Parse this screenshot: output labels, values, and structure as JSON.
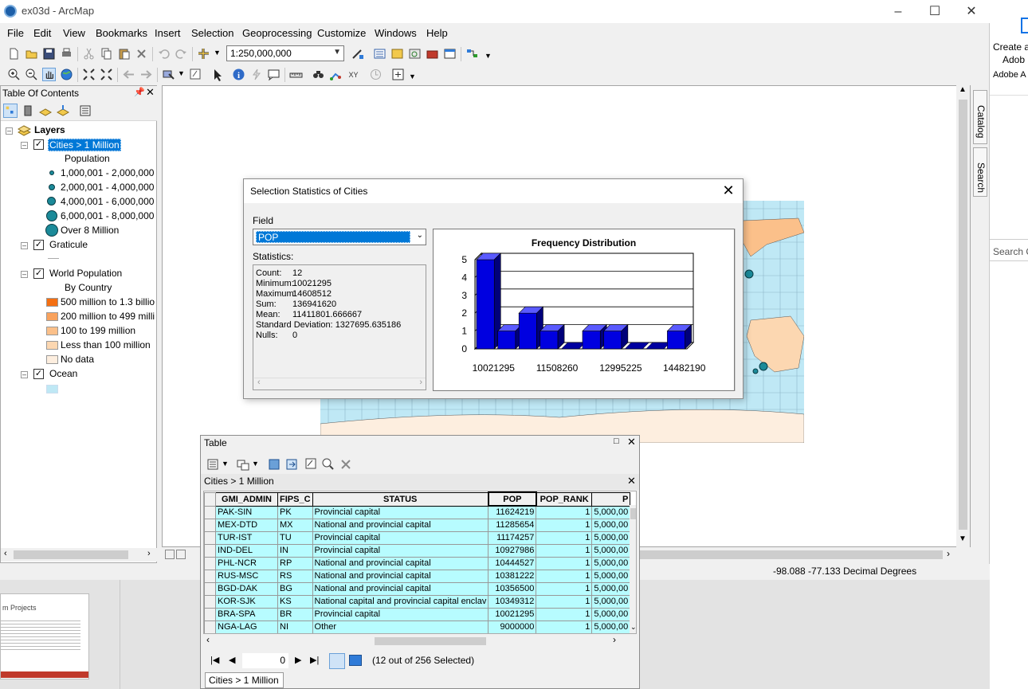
{
  "window": {
    "title": "ex03d - ArcMap"
  },
  "menu": [
    "File",
    "Edit",
    "View",
    "Bookmarks",
    "Insert",
    "Selection",
    "Geoprocessing",
    "Customize",
    "Windows",
    "Help"
  ],
  "toolbar": {
    "scale": "1:250,000,000"
  },
  "toc": {
    "title": "Table Of Contents",
    "root": "Layers",
    "cities_layer": "Cities > 1 Million",
    "cities_field": "Population",
    "cities_classes": [
      "1,000,001 - 2,000,000",
      "2,000,001 - 4,000,000",
      "4,000,001 - 6,000,000",
      "6,000,001 - 8,000,000",
      "Over 8 Million"
    ],
    "graticule_layer": "Graticule",
    "worldpop_layer": "World Population",
    "worldpop_field": "By Country",
    "worldpop_classes": [
      "500 million to 1.3 billio",
      "200 million to 499 milli",
      "100 to 199 million",
      "Less than 100 million",
      "No data"
    ],
    "worldpop_colors": [
      "#f46f12",
      "#f9a25d",
      "#fbc08a",
      "#fcd7b1",
      "#fdeedf"
    ],
    "ocean_layer": "Ocean",
    "ocean_color": "#bfe8f5"
  },
  "dock": {
    "catalog": "Catalog",
    "search": "Search"
  },
  "status": {
    "coords": "-98.088  -77.133 Decimal Degrees"
  },
  "bg_app": {
    "line1": "Create a",
    "line2": "Adob",
    "line3": "Adobe A",
    "search": "Search C"
  },
  "doc_thumb": {
    "title": "m Projects"
  },
  "dialog": {
    "title": "Selection Statistics of Cities",
    "field_label": "Field",
    "field_value": "POP",
    "stats_label": "Statistics:",
    "stats": [
      {
        "k": "Count:",
        "v": "12"
      },
      {
        "k": "Minimum:",
        "v": "10021295"
      },
      {
        "k": "Maximum:",
        "v": "14608512"
      },
      {
        "k": "Sum:",
        "v": "136941620"
      },
      {
        "k": "Mean:",
        "v": "11411801.666667"
      },
      {
        "k": "Standard Deviation:",
        "v": "1327695.635186"
      },
      {
        "k": "Nulls:",
        "v": "0"
      }
    ]
  },
  "chart_data": {
    "type": "bar",
    "title": "Frequency Distribution",
    "values": [
      5,
      1,
      2,
      1,
      0,
      1,
      1,
      0,
      0,
      1
    ],
    "xtick_labels": [
      "10021295",
      "11508260",
      "12995225",
      "14482190"
    ],
    "ylim": [
      0,
      5
    ],
    "yticks": [
      "0",
      "1",
      "2",
      "3",
      "4",
      "5"
    ],
    "bar_color": "#0000e0",
    "grid": true
  },
  "table": {
    "window_title": "Table",
    "layer_name": "Cities > 1 Million",
    "columns": [
      "GMI_ADMIN",
      "FIPS_C",
      "STATUS",
      "POP",
      "POP_RANK",
      "P"
    ],
    "rows": [
      [
        "PAK-SIN",
        "PK",
        "Provincial capital",
        "11624219",
        "1",
        "5,000,00"
      ],
      [
        "MEX-DTD",
        "MX",
        "National and provincial capital",
        "11285654",
        "1",
        "5,000,00"
      ],
      [
        "TUR-IST",
        "TU",
        "Provincial capital",
        "11174257",
        "1",
        "5,000,00"
      ],
      [
        "IND-DEL",
        "IN",
        "Provincial capital",
        "10927986",
        "1",
        "5,000,00"
      ],
      [
        "PHL-NCR",
        "RP",
        "National and provincial capital",
        "10444527",
        "1",
        "5,000,00"
      ],
      [
        "RUS-MSC",
        "RS",
        "National and provincial capital",
        "10381222",
        "1",
        "5,000,00"
      ],
      [
        "BGD-DAK",
        "BG",
        "National and provincial capital",
        "10356500",
        "1",
        "5,000,00"
      ],
      [
        "KOR-SJK",
        "KS",
        "National capital and provincial capital enclav",
        "10349312",
        "1",
        "5,000,00"
      ],
      [
        "BRA-SPA",
        "BR",
        "Provincial capital",
        "10021295",
        "1",
        "5,000,00"
      ],
      [
        "NGA-LAG",
        "NI",
        "Other",
        "9000000",
        "1",
        "5,000,00"
      ]
    ],
    "record": "0",
    "selected_text": "(12 out of 256 Selected)",
    "tab_label": "Cities > 1 Million"
  }
}
